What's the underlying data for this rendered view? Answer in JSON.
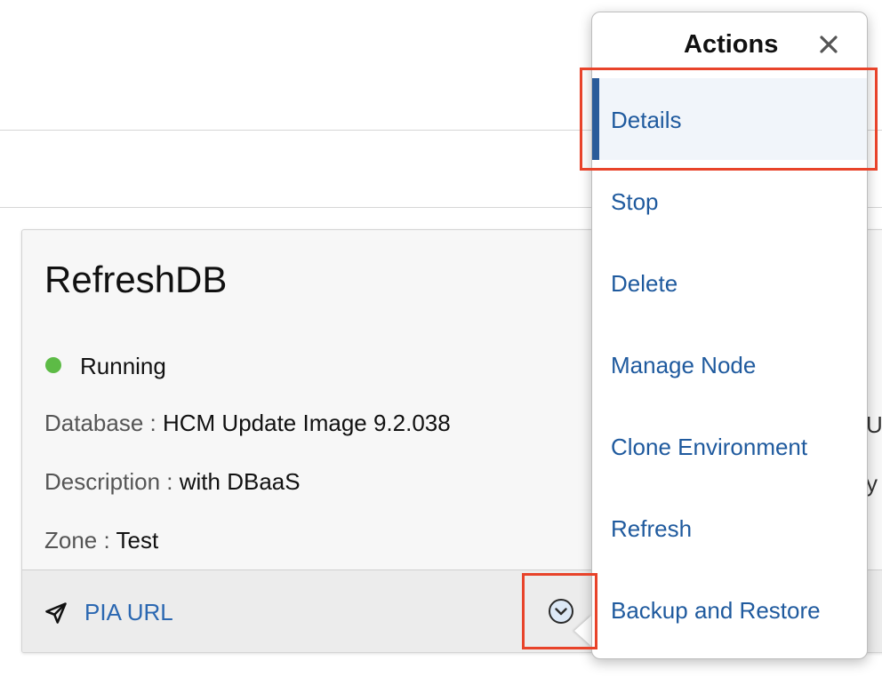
{
  "card": {
    "title": "RefreshDB",
    "status": "Running",
    "status_color": "#5dbb46",
    "fields": [
      {
        "label": "Database :",
        "value": "HCM Update Image 9.2.038"
      },
      {
        "label": "Description :",
        "value": "with DBaaS"
      },
      {
        "label": "Zone :",
        "value": "Test"
      }
    ],
    "right_cut": [
      "U",
      "y"
    ],
    "footer": {
      "link_icon": "navigation-arrow-icon",
      "link_label": "PIA URL",
      "menu_toggle_icon": "chevron-down-circle-icon"
    }
  },
  "actions_popup": {
    "title": "Actions",
    "close_icon": "close-icon",
    "items": [
      {
        "label": "Details",
        "selected": true
      },
      {
        "label": "Stop"
      },
      {
        "label": "Delete"
      },
      {
        "label": "Manage Node"
      },
      {
        "label": "Clone Environment"
      },
      {
        "label": "Refresh"
      },
      {
        "label": "Backup and Restore"
      }
    ]
  },
  "colors": {
    "link": "#2a67b1",
    "menu_text": "#1f5a9e",
    "selected_bar": "#2a5c9a",
    "highlight_box": "#e8432a"
  }
}
